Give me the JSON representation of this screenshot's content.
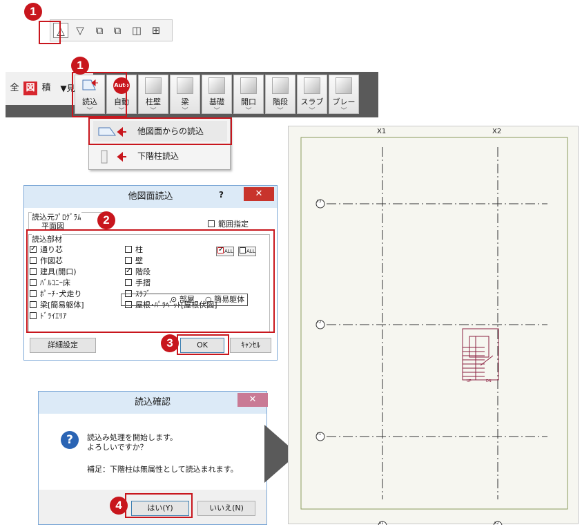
{
  "markers": [
    "1",
    "1",
    "2",
    "3",
    "4"
  ],
  "colors": {
    "accent": "#c8161d",
    "toolbar_dark": "#5a5a5a",
    "dialog_title": "#dceaf7",
    "close": "#c8342c"
  },
  "toolbar1": {
    "icons": [
      "△",
      "▽",
      "⧉",
      "⧉",
      "◫",
      "⊞"
    ]
  },
  "toolbar2": {
    "quick": [
      "全",
      "図",
      "積",
      "▼見下"
    ],
    "buttons": [
      {
        "label": "読込",
        "icon": "import-icon"
      },
      {
        "label": "自動",
        "badge": "Auto",
        "icon": "auto-icon"
      },
      {
        "label": "柱壁",
        "icon": "pillar-wall-icon"
      },
      {
        "label": "梁",
        "icon": "beam-icon"
      },
      {
        "label": "基礎",
        "icon": "foundation-icon"
      },
      {
        "label": "開口",
        "icon": "opening-icon"
      },
      {
        "label": "階段",
        "icon": "stairs-icon"
      },
      {
        "label": "スラブ",
        "icon": "slab-icon"
      },
      {
        "label": "ブレー",
        "icon": "brace-icon"
      }
    ],
    "chevron": "﹀"
  },
  "dropdown": {
    "items": [
      "他図面からの読込",
      "下階柱読込"
    ]
  },
  "dialog1": {
    "title": "他図面読込",
    "help": "?",
    "close": "✕",
    "source_group": "読込元ﾌﾟﾛｸﾞﾗﾑ",
    "source_value": "平面図",
    "range_label": "範囲指定",
    "members_group": "読込部材",
    "col1": [
      {
        "label": "通り芯",
        "checked": true
      },
      {
        "label": "作図芯",
        "checked": false
      },
      {
        "label": "建具(開口)",
        "checked": false
      },
      {
        "label": "ﾊﾞﾙｺﾆｰ床",
        "checked": false
      },
      {
        "label": "ﾎﾟｰﾁ･犬走り",
        "checked": false
      },
      {
        "label": "梁[簡易躯体]",
        "checked": false
      },
      {
        "label": "ﾄﾞﾗｲｴﾘｱ",
        "checked": false
      }
    ],
    "col2": [
      {
        "label": "柱",
        "checked": false
      },
      {
        "label": "壁",
        "checked": false
      },
      {
        "label": "階段",
        "checked": true
      },
      {
        "label": "手摺",
        "checked": false
      },
      {
        "label": "ｽﾗﾌﾞ",
        "checked": false
      },
      {
        "label": "屋根･ﾊﾟﾗﾍﾟｯﾄ[屋根伏図]",
        "checked": false
      }
    ],
    "all_on": "ALL",
    "all_off": "ALL",
    "slab_opt1": "部屋",
    "slab_opt2": "簡易躯体",
    "detail_btn": "詳細設定",
    "ok_btn": "OK",
    "cancel_btn": "ｷｬﾝｾﾙ"
  },
  "dialog2": {
    "title": "読込確認",
    "close": "✕",
    "question_icon": "?",
    "line1": "読込み処理を開始します。",
    "line2": "よろしいですか？",
    "note": "補足：下階柱は無属性として読込まれます。",
    "yes_btn": "はい(Y)",
    "no_btn": "いいえ(N)"
  },
  "canvas": {
    "grid_x": [
      "X1",
      "X2"
    ],
    "grid_y": [
      "Y3",
      "Y2",
      "Y1"
    ],
    "stair_labels": [
      "UP",
      "DN"
    ]
  }
}
